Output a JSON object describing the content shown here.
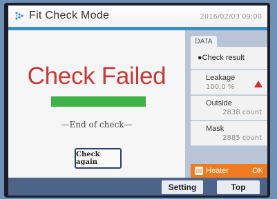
{
  "header": {
    "title": "Fit Check Mode",
    "datetime": "2016/02/03 09:00",
    "accent_color": "#3a8fc6",
    "icon": "dots-icon"
  },
  "main": {
    "status": "Check Failed",
    "status_color": "#c63a38",
    "progress": 1.0,
    "progress_color": "#3fb34a",
    "end_text": "—End of check—",
    "check_again_label": "Check again"
  },
  "side": {
    "tab_label": "DATA",
    "check_result_label": "●Check result",
    "leakage": {
      "label": "Leakage",
      "value": "100.0 %",
      "icon": "warning-triangle-icon"
    },
    "outside": {
      "label": "Outside",
      "value": "2838 count"
    },
    "mask": {
      "label": "Mask",
      "value": "2885 count"
    },
    "heater": {
      "label": "Heater",
      "status": "OK",
      "icon": "heater-icon",
      "color": "#f07a20"
    }
  },
  "footer": {
    "setting_label": "Setting",
    "top_label": "Top"
  }
}
